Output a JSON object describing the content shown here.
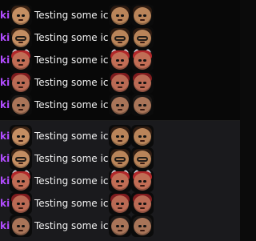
{
  "chat": {
    "top_rows": [
      {
        "name": "ki:",
        "message": "Testing some icons",
        "emotes": [
          "face-with-headband-icon",
          "face-brown-hair-icon",
          "face-brown-hair-icon"
        ]
      },
      {
        "name": "ki:",
        "message": "Testing some icons",
        "emotes": [
          "face-with-glasses-icon",
          "face-with-glasses-icon",
          "face-with-glasses-icon"
        ]
      },
      {
        "name": "ki:",
        "message": "Testing some icons",
        "emotes": [
          "face-red-hair-horns-icon",
          "face-red-hair-horns-icon",
          "face-red-hair-horns-icon"
        ]
      },
      {
        "name": "ki:",
        "message": "Testing some icons",
        "emotes": [
          "face-red-hair-icon",
          "face-red-hair-icon",
          "face-red-hair-icon"
        ]
      },
      {
        "name": "ki:",
        "message": "Testing some icons",
        "emotes": [
          "face-brown-hair-icon",
          "face-brown-hair-icon",
          "face-brown-hair-icon"
        ]
      }
    ],
    "bottom_rows": [
      {
        "name": "ki:",
        "message": "Testing some icons",
        "emotes": [
          "face-brown-hair-icon",
          "face-brown-hair-icon",
          "face-brown-hair-icon"
        ]
      },
      {
        "name": "ki:",
        "message": "Testing some icons",
        "emotes": [
          "face-with-glasses-icon",
          "face-with-glasses-icon",
          "face-with-glasses-icon"
        ]
      },
      {
        "name": "ki:",
        "message": "Testing some icons",
        "emotes": [
          "face-red-hair-horns-icon",
          "face-red-hair-horns-icon",
          "face-red-hair-horns-icon"
        ]
      },
      {
        "name": "ki:",
        "message": "Testing some icons",
        "emotes": [
          "face-red-hair-icon",
          "face-red-hair-icon",
          "face-red-hair-icon"
        ]
      },
      {
        "name": "ki:",
        "message": "Testing some icons",
        "emotes": [
          "face-brown-hair-icon",
          "face-brown-hair-icon",
          "face-brown-hair-icon"
        ]
      }
    ]
  },
  "colors": {
    "username": "#b24cff",
    "message": "#f2f2f2",
    "top_bg": "#080808",
    "bottom_bg": "#1a1a1d"
  }
}
